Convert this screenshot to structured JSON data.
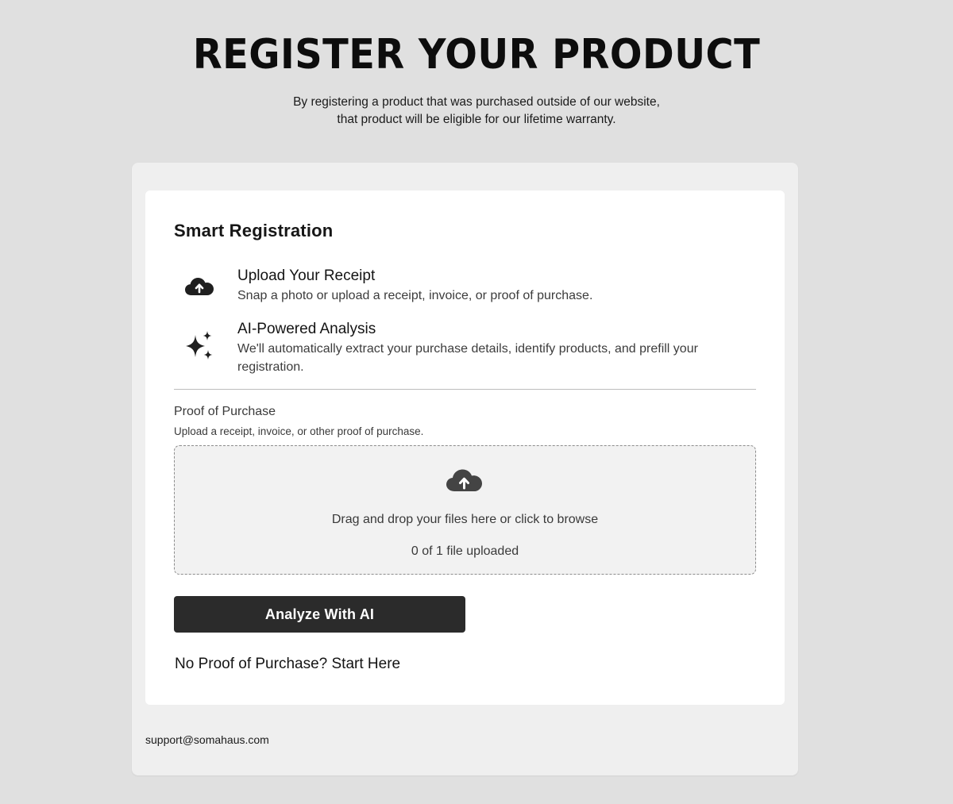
{
  "header": {
    "title": "REGISTER YOUR PRODUCT",
    "subtitle_line1": "By registering a product that was purchased outside of our website,",
    "subtitle_line2": "that product will be eligible for our lifetime warranty."
  },
  "smart_registration": {
    "title": "Smart Registration",
    "features": [
      {
        "icon": "cloud-upload-icon",
        "title": "Upload Your Receipt",
        "description": "Snap a photo or upload a receipt, invoice, or proof of purchase."
      },
      {
        "icon": "sparkles-icon",
        "title": "AI-Powered Analysis",
        "description": "We'll automatically extract your purchase details, identify products, and prefill your registration."
      }
    ]
  },
  "proof_of_purchase": {
    "label": "Proof of Purchase",
    "help_text": "Upload a receipt, invoice, or other proof of purchase.",
    "dropzone_text": "Drag and drop your files here or click to browse",
    "upload_count": "0 of 1 file uploaded",
    "icon": "cloud-upload-icon"
  },
  "actions": {
    "analyze_label": "Analyze With AI",
    "no_proof_label": "No Proof of Purchase? Start Here"
  },
  "footer": {
    "support_email": "support@somahaus.com"
  },
  "colors": {
    "page_bg": "#e0e0e0",
    "outer_card_bg": "#efefef",
    "inner_card_bg": "#ffffff",
    "button_bg": "#2b2b2b",
    "dropzone_bg": "#f2f2f2"
  }
}
